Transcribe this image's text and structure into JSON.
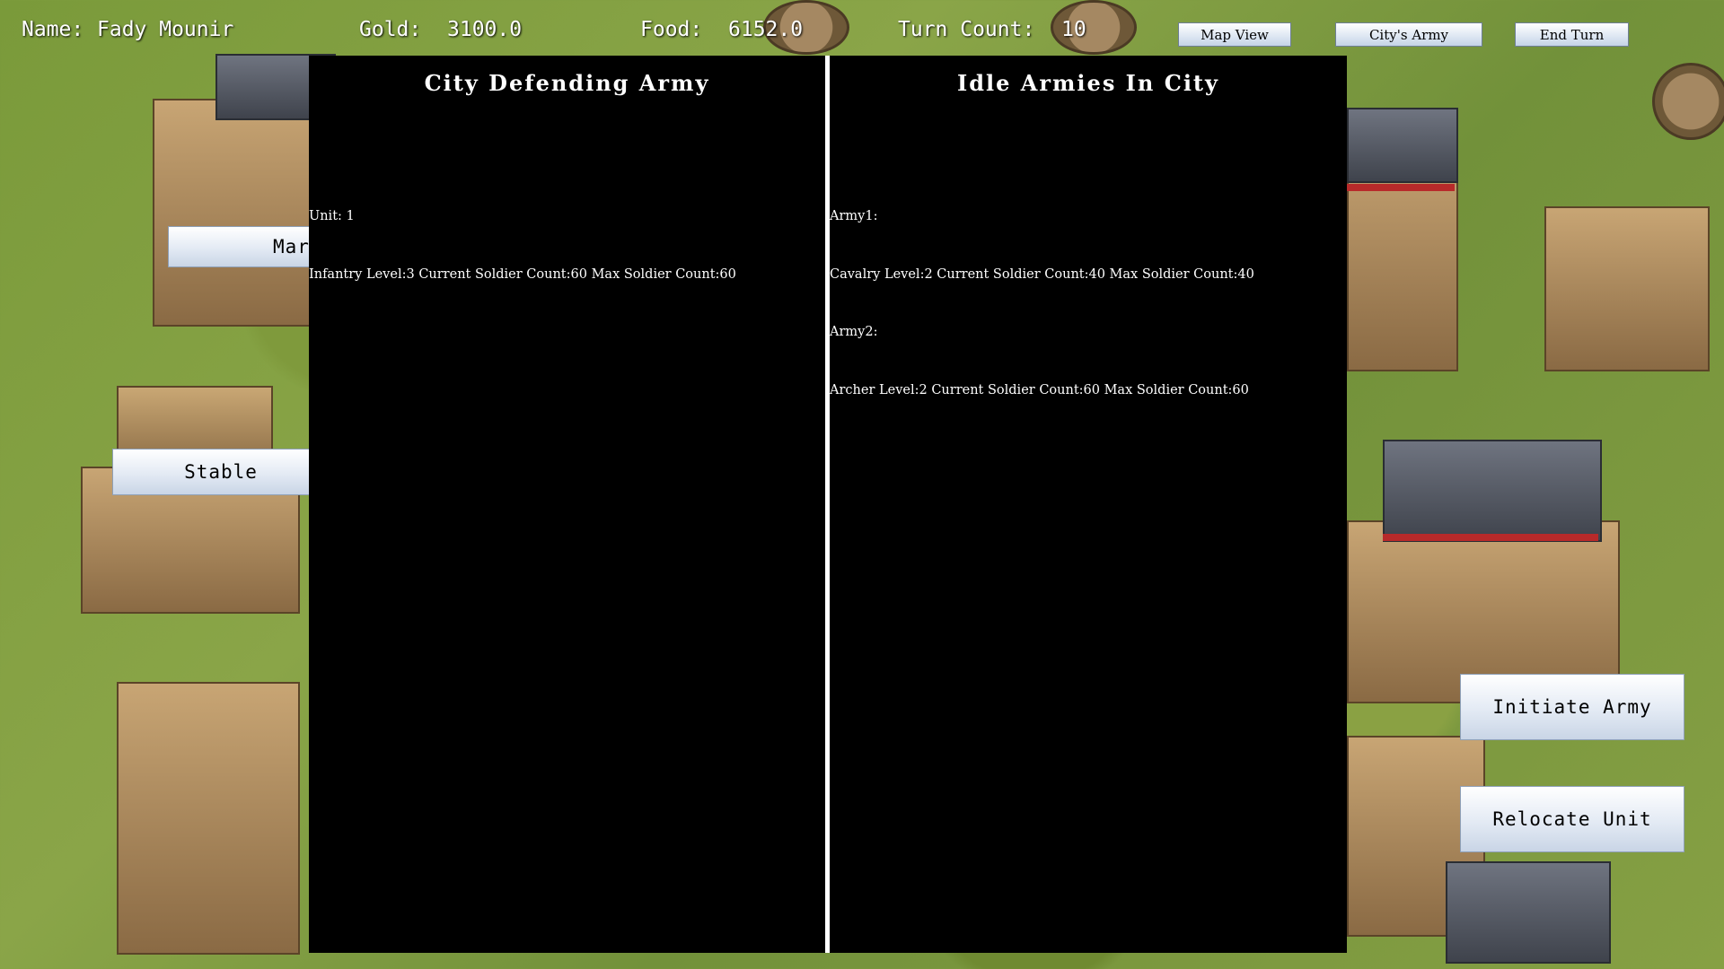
{
  "hud": {
    "name_label": "Name:",
    "name_value": "Fady Mounir",
    "gold_label": "Gold:",
    "gold_value": "3100.0",
    "food_label": "Food:",
    "food_value": "6152.0",
    "turn_label": "Turn Count:",
    "turn_value": "10"
  },
  "top_buttons": {
    "map_view": "Map View",
    "city_army": "City's Army",
    "end_turn": "End Turn"
  },
  "side_buttons": {
    "market_partial": "Mar",
    "stable": "Stable",
    "initiate_army": "Initiate Army",
    "relocate_unit": "Relocate Unit"
  },
  "left_panel": {
    "title": "City Defending Army",
    "lines": [
      "Unit: 1",
      "Infantry Level:3 Current Soldier Count:60 Max Soldier Count:60"
    ]
  },
  "right_panel": {
    "title": "Idle Armies In City",
    "lines": [
      "Army1:",
      "Cavalry Level:2 Current Soldier Count:40 Max Soldier Count:40",
      "Army2:",
      "Archer Level:2 Current Soldier Count:60 Max Soldier Count:60"
    ]
  }
}
